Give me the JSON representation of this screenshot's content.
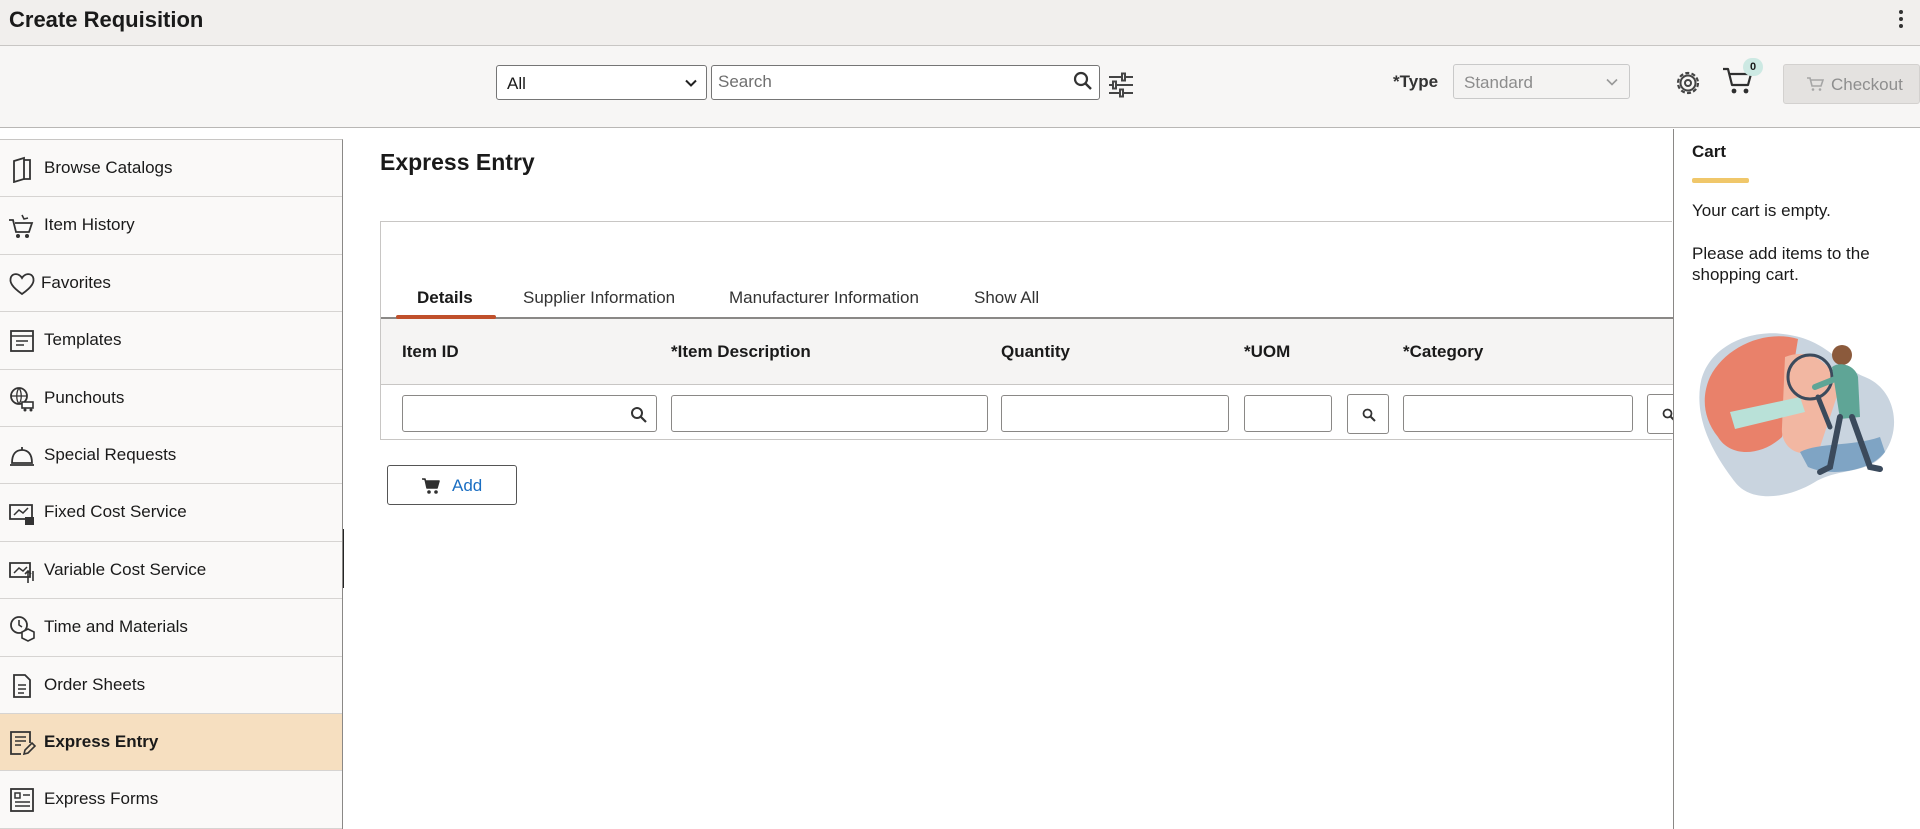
{
  "header": {
    "title": "Create Requisition"
  },
  "toolbar": {
    "scope": "All",
    "search_placeholder": "Search",
    "type_label": "*Type",
    "type_value": "Standard",
    "cart_count": "0",
    "checkout_label": "Checkout"
  },
  "sidebar": {
    "items": [
      {
        "label": "Browse Catalogs",
        "icon": "catalog-icon"
      },
      {
        "label": "Item History",
        "icon": "item-history-icon"
      },
      {
        "label": "Favorites",
        "icon": "heart-icon"
      },
      {
        "label": "Templates",
        "icon": "template-icon"
      },
      {
        "label": "Punchouts",
        "icon": "punchout-icon"
      },
      {
        "label": "Special Requests",
        "icon": "bell-icon"
      },
      {
        "label": "Fixed Cost Service",
        "icon": "fixed-cost-icon"
      },
      {
        "label": "Variable Cost Service",
        "icon": "variable-cost-icon"
      },
      {
        "label": "Time and Materials",
        "icon": "time-materials-icon"
      },
      {
        "label": "Order Sheets",
        "icon": "document-icon"
      },
      {
        "label": "Express Entry",
        "icon": "express-entry-icon",
        "active": true
      },
      {
        "label": "Express Forms",
        "icon": "form-icon"
      }
    ]
  },
  "main": {
    "title": "Express Entry",
    "tabs": [
      "Details",
      "Supplier Information",
      "Manufacturer Information",
      "Show All"
    ],
    "active_tab": "Details",
    "columns": [
      "Item ID",
      "*Item Description",
      "Quantity",
      "*UOM",
      "*Category"
    ],
    "add_label": "Add"
  },
  "cart": {
    "title": "Cart",
    "empty_message": "Your cart is empty.",
    "hint": "Please add items to the shopping cart."
  },
  "colors": {
    "active_nav": "#f6dfc0",
    "tab_accent": "#c0502b",
    "cart_accent": "#f0c76a",
    "link": "#1a6ec2"
  }
}
